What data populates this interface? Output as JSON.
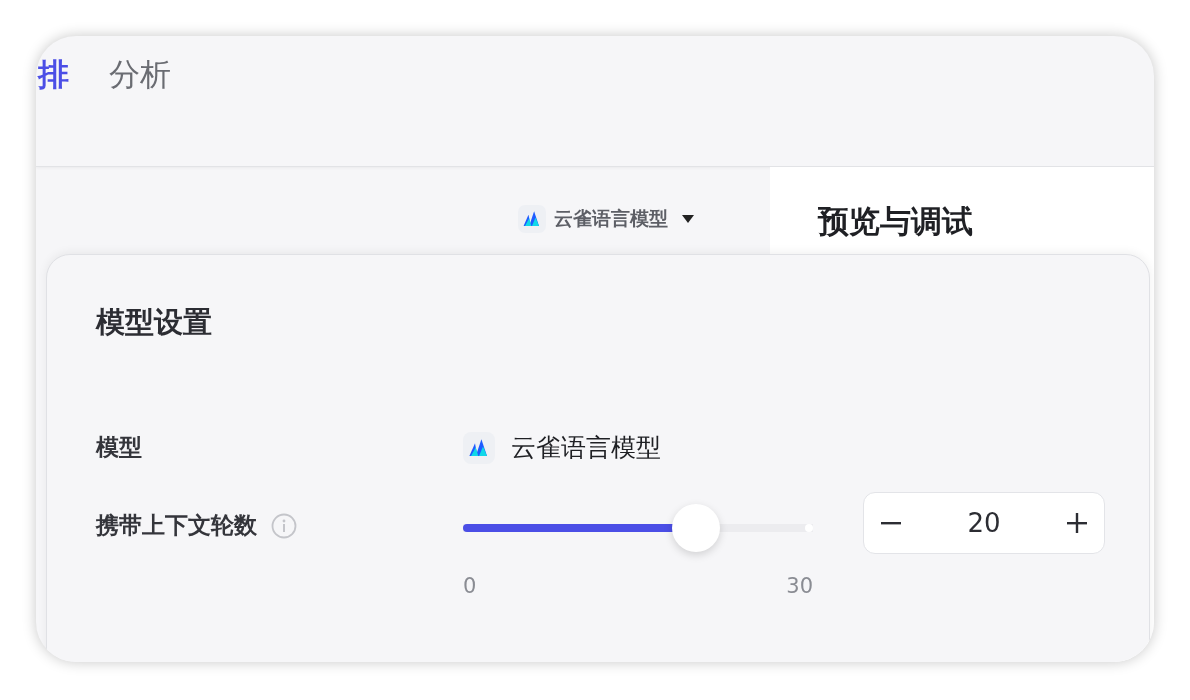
{
  "tabs": [
    {
      "label": "排",
      "selected": true
    },
    {
      "label": "分析",
      "selected": false
    }
  ],
  "model_selector": {
    "label": "云雀语言模型"
  },
  "preview_panel": {
    "title": "预览与调试"
  },
  "model_settings": {
    "title": "模型设置",
    "model": {
      "label": "模型",
      "value": "云雀语言模型"
    },
    "context_rounds": {
      "label": "携带上下文轮数",
      "level": 0.667,
      "min": "0",
      "max": "30",
      "value": "20"
    }
  }
}
